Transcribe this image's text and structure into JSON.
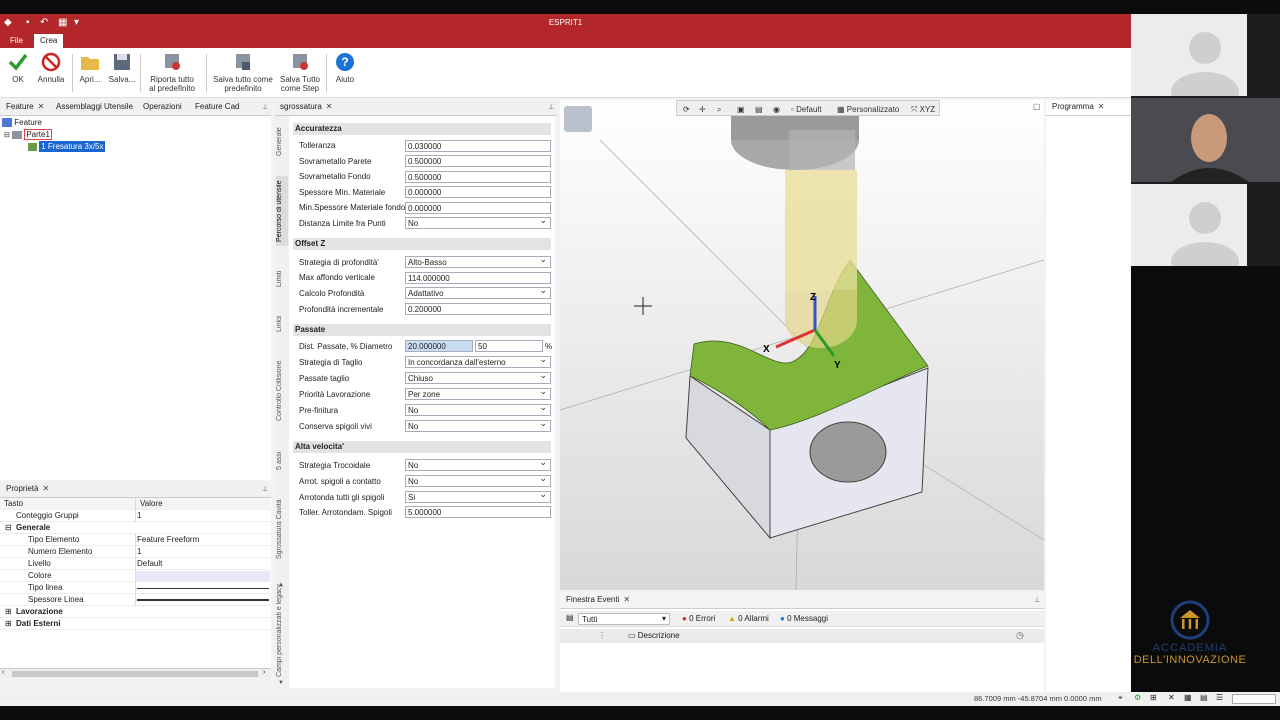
{
  "app": {
    "title": "ESPRIT1"
  },
  "menu": {
    "file": "File",
    "crea": "Crea"
  },
  "ribbon": {
    "ok": "OK",
    "annulla": "Annulla",
    "apri": "Apri...",
    "salva": "Salva...",
    "riporta_1": "Riporta tutto",
    "riporta_2": "al predefinito",
    "salva_tutto_1": "Salva tutto come",
    "salva_tutto_2": "predefinito",
    "salva_step_1": "Salva Tutto",
    "salva_step_2": "come Step",
    "aiuto": "Aiuto"
  },
  "left_tabs": [
    "Feature",
    "Assemblaggi Utensile",
    "Operazioni",
    "Feature Cad"
  ],
  "tree": {
    "root": "Feature",
    "part": "Parte1",
    "op": "1 Fresatura 3x/5x"
  },
  "props": {
    "tab": "Proprietà",
    "col_key": "Tasto",
    "col_val": "Valore",
    "rows": [
      {
        "k": "Conteggio Gruppi",
        "v": "1"
      },
      {
        "k": "Generale",
        "v": ""
      },
      {
        "k": "Tipo Elemento",
        "v": "Feature Freeform"
      },
      {
        "k": "Numero Elemento",
        "v": "1"
      },
      {
        "k": "Livello",
        "v": "Default"
      },
      {
        "k": "Colore",
        "v": ""
      },
      {
        "k": "Tipo linea",
        "v": ""
      },
      {
        "k": "Spessore Linea",
        "v": ""
      },
      {
        "k": "Lavorazione",
        "v": ""
      },
      {
        "k": "Dati Esterni",
        "v": ""
      }
    ]
  },
  "op_tab": "sgrossatura",
  "vtabs": [
    "Generale",
    "Percorso di utensile",
    "Limiti",
    "Links",
    "Controllo Collisione",
    "5 assi",
    "Sgrossatura Cavità",
    "Campi personalizzati e legacy"
  ],
  "sections": {
    "accuratezza": "Accuratezza",
    "offset_z": "Offset Z",
    "passate": "Passate",
    "alta_velocita": "Alta velocita'"
  },
  "params": {
    "tolleranza": {
      "label": "Tolleranza",
      "value": "0.030000"
    },
    "sovr_parete": {
      "label": "Sovrametallo Parete",
      "value": "0.500000"
    },
    "sovr_fondo": {
      "label": "Sovrametallo Fondo",
      "value": "0.500000"
    },
    "spess_min": {
      "label": "Spessore Min. Materiale",
      "value": "0.000000"
    },
    "min_spess_fondo": {
      "label": "Min.Spessore Materiale fondo",
      "value": "0.000000"
    },
    "dist_limite": {
      "label": "Distanza Limite fra Punti",
      "value": "No"
    },
    "strategia_prof": {
      "label": "Strategia di profondità'",
      "value": "Alto-Basso"
    },
    "max_affondo": {
      "label": "Max affondo verticale",
      "value": "114.000000"
    },
    "calcolo_prof": {
      "label": "Calcolo Profondità",
      "value": "Adattativo"
    },
    "prof_incr": {
      "label": "Profondità incrementale",
      "value": "0.200000"
    },
    "dist_passate": {
      "label": "Dist. Passate, % Diametro",
      "value": "20.000000",
      "value2": "50",
      "unit": "%"
    },
    "strategia_taglio": {
      "label": "Strategia di Taglio",
      "value": "In concordanza dall'esterno"
    },
    "passate_taglio": {
      "label": "Passate taglio",
      "value": "Chiuso"
    },
    "priorita": {
      "label": "Priorità Lavorazione",
      "value": "Per zone"
    },
    "prefinitura": {
      "label": "Pre-finitura",
      "value": "No"
    },
    "conserva": {
      "label": "Conserva spigoli vivi",
      "value": "No"
    },
    "trocoidale": {
      "label": "Strategia Trocoidale",
      "value": "No"
    },
    "arrot_contatto": {
      "label": "Arrot. spigoli a contatto",
      "value": "No"
    },
    "arrot_tutti": {
      "label": "Arrotonda tutti gli spigoli",
      "value": "Si"
    },
    "toller_arrot": {
      "label": "Toller. Arrotondam. Spigoli",
      "value": "5.000000"
    }
  },
  "viewport": {
    "default": "Default",
    "personalizzato": "Personalizzato",
    "xyz": "XYZ",
    "axis_x": "X",
    "axis_y": "Y",
    "axis_z": "Z"
  },
  "events": {
    "tab": "Finestra Eventi",
    "filter": "Tutti",
    "errori": "0 Errori",
    "allarmi": "0 Allarmi",
    "messaggi": "0 Messaggi",
    "descrizione": "Descrizione"
  },
  "programma_tab": "Programma",
  "status": {
    "coords": "86.7009 mm  -45.8704 mm  0.0000 mm"
  },
  "logo": {
    "line1": "ACCADEMIA",
    "line2": "DELL'INNOVAZIONE"
  },
  "colors": {
    "brand": "#b32629",
    "accent_green": "#7fb53a",
    "logo_blue": "#1f3f7a",
    "logo_gold": "#c9962a"
  }
}
